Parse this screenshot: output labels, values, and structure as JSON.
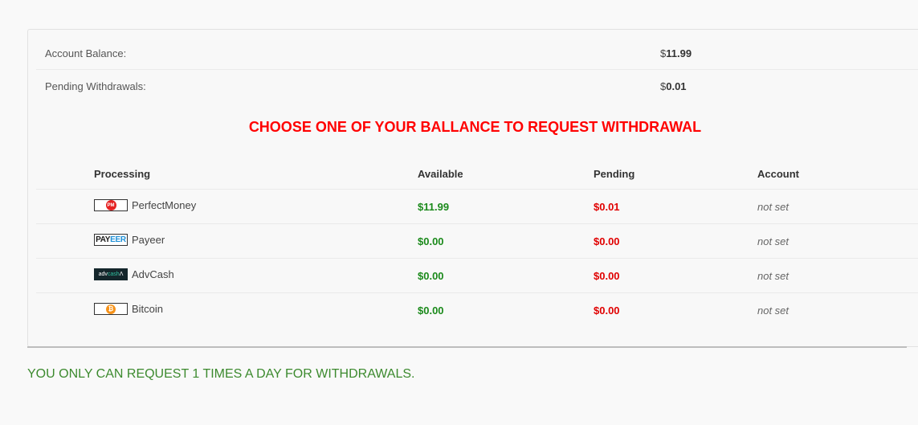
{
  "summary": {
    "balance_label": "Account Balance:",
    "balance_currency": "$",
    "balance_value": "11.99",
    "pending_label": "Pending Withdrawals:",
    "pending_currency": "$",
    "pending_value": "0.01"
  },
  "headline": "CHOOSE ONE OF YOUR BALLANCE TO REQUEST WITHDRAWAL",
  "table": {
    "headers": [
      "Processing",
      "Available",
      "Pending",
      "Account"
    ],
    "rows": [
      {
        "name": "PerfectMoney",
        "logo": "perfectmoney-logo",
        "available": "$11.99",
        "pending": "$0.01",
        "account": "not set"
      },
      {
        "name": "Payeer",
        "logo": "payeer-logo",
        "available": "$0.00",
        "pending": "$0.00",
        "account": "not set"
      },
      {
        "name": "AdvCash",
        "logo": "advcash-logo",
        "available": "$0.00",
        "pending": "$0.00",
        "account": "not set"
      },
      {
        "name": "Bitcoin",
        "logo": "bitcoin-logo",
        "available": "$0.00",
        "pending": "$0.00",
        "account": "not set"
      }
    ]
  },
  "logo_text": {
    "pm": "PM",
    "payeer_a": "PAY",
    "payeer_b": "EER",
    "adv_a": "adv",
    "adv_b": "cash",
    "adv_c": " Λ",
    "btc": "₿"
  },
  "note": "YOU ONLY CAN REQUEST 1 TIMES A DAY FOR WITHDRAWALS.",
  "colors": {
    "headline": "#ff0000",
    "available": "#1b8a1b",
    "pending": "#e00000",
    "note": "#3c8a2e"
  }
}
